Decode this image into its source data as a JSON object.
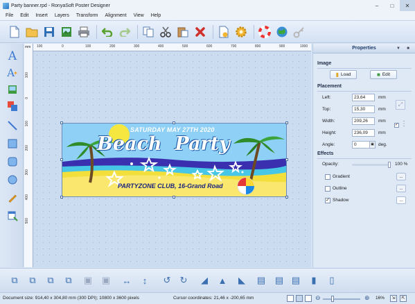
{
  "window": {
    "title": "Party banner.rpd - RonyaSoft Poster Designer"
  },
  "menu": [
    "File",
    "Edit",
    "Insert",
    "Layers",
    "Transform",
    "Alignment",
    "View",
    "Help"
  ],
  "ruler": {
    "corner": "mm",
    "top_ticks": [
      "100",
      "0",
      "100",
      "200",
      "300",
      "400",
      "500",
      "600",
      "700",
      "800",
      "900",
      "1000"
    ],
    "left_ticks": [
      "100",
      "0",
      "100",
      "200",
      "300",
      "400",
      "500"
    ]
  },
  "poster": {
    "date_text": "SATURDAY MAY 27TH 2020",
    "title_text": "Beach  Party",
    "venue_text": "PARTYZONE CLUB, 16-Grand Road"
  },
  "properties": {
    "header": "Properties",
    "image_section": "Image",
    "load_label": "Load",
    "edit_label": "Edit",
    "placement_section": "Placement",
    "left_label": "Left:",
    "left_value": "23,64",
    "top_label": "Top:",
    "top_value": "15,30",
    "width_label": "Width:",
    "width_value": "209,26",
    "height_label": "Height:",
    "height_value": "236,09",
    "angle_label": "Angle:",
    "angle_value": "0",
    "unit_mm": "mm",
    "unit_deg": "deg.",
    "effects_section": "Effects",
    "opacity_label": "Opacity:",
    "opacity_value": "100 %",
    "opacity_fraction": 1.0,
    "gradient_label": "Gradient",
    "outline_label": "Outline",
    "shadow_label": "Shadow",
    "gradient_checked": false,
    "outline_checked": false,
    "shadow_checked": true,
    "dots": "..."
  },
  "status": {
    "document_size": "Document size: 914,40 x 304,80 mm (300 DPI); 10800 x 3600 pixels",
    "cursor": "Cursor coordinates: 21,46 x -200,65 mm",
    "zoom": "16%"
  },
  "colors": {
    "accent": "#2a6ebb",
    "panel": "#dfe9f6",
    "canvas": "#ccdcf0",
    "poster_sky": "#7ec8f2",
    "poster_sand": "#f3df3c",
    "poster_text": "#1a237e"
  }
}
